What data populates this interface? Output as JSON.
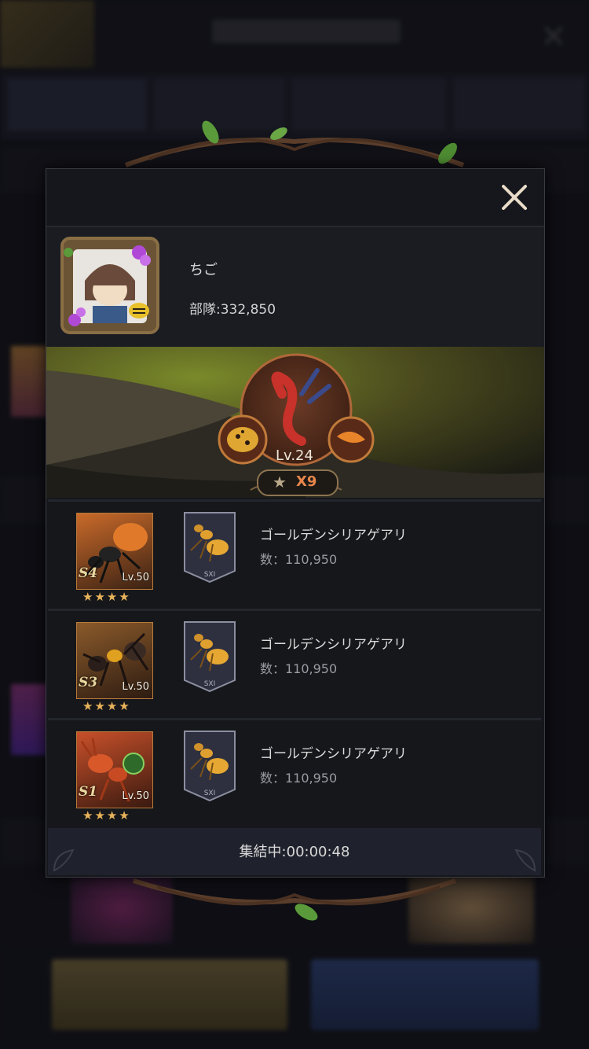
{
  "player": {
    "name": "ちご",
    "troop_label": "部隊:332,850"
  },
  "leader": {
    "level": "Lv.24",
    "stars": "X9"
  },
  "units": [
    {
      "tier": "S4",
      "level": "Lv.50",
      "stars": "★★★★",
      "insignia": "SXI",
      "name": "ゴールデンシリアゲアリ",
      "count": "数：110,950",
      "color": "#c96a2a"
    },
    {
      "tier": "S3",
      "level": "Lv.50",
      "stars": "★★★★",
      "insignia": "SXI",
      "name": "ゴールデンシリアゲアリ",
      "count": "数：110,950",
      "color": "#8a5a2a"
    },
    {
      "tier": "S1",
      "level": "Lv.50",
      "stars": "★★★★",
      "insignia": "SXI",
      "name": "ゴールデンシリアゲアリ",
      "count": "数：110,950",
      "color": "#c8502a"
    }
  ],
  "footer": {
    "status": "集結中:00:00:48"
  },
  "colors": {
    "accent": "#e8864c",
    "frame": "#b87a3a"
  }
}
